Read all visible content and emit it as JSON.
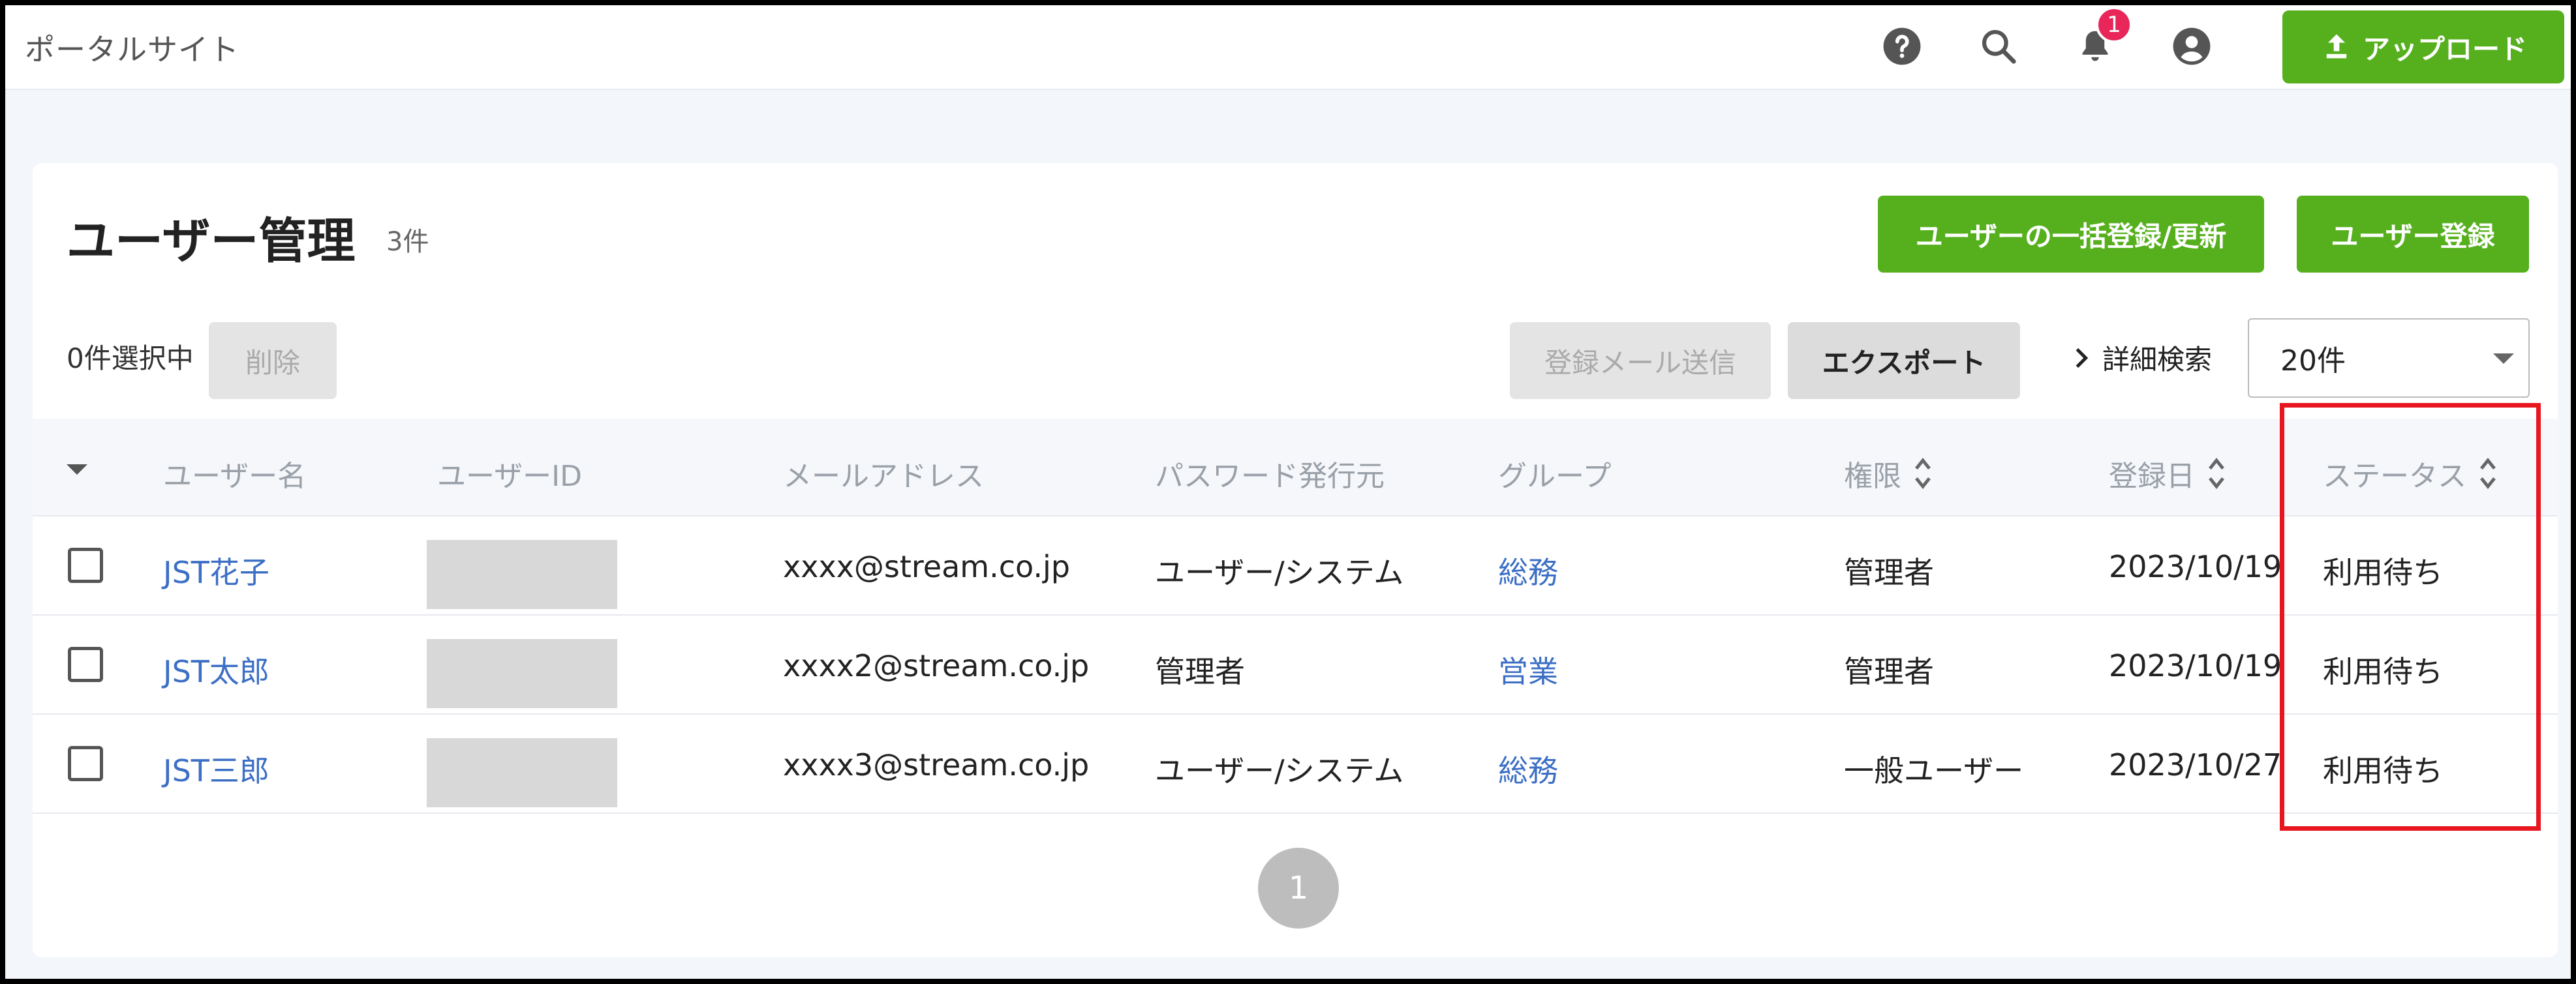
{
  "header": {
    "site_title": "ポータルサイト",
    "help_icon": "help-circle-icon",
    "search_icon": "search-icon",
    "bell_icon": "bell-icon",
    "notification_count": "1",
    "account_icon": "account-circle-icon",
    "upload_label": "アップロード"
  },
  "page": {
    "title": "ユーザー管理",
    "count": "3件",
    "bulk_register_label": "ユーザーの一括登録/更新",
    "register_label": "ユーザー登録",
    "selected_text": "0件選択中",
    "delete_label": "削除",
    "send_mail_label": "登録メール送信",
    "export_label": "エクスポート",
    "advanced_search_label": "詳細検索",
    "per_page_value": "20件"
  },
  "table": {
    "columns": [
      "ユーザー名",
      "ユーザーID",
      "メールアドレス",
      "パスワード発行元",
      "グループ",
      "権限",
      "登録日",
      "ステータス"
    ],
    "rows": [
      {
        "name": "JST花子",
        "email": "xxxx@stream.co.jp",
        "issuer": "ユーザー/システム",
        "group": "総務",
        "role": "管理者",
        "date": "2023/10/19",
        "status": "利用待ち"
      },
      {
        "name": "JST太郎",
        "email": "xxxx2@stream.co.jp",
        "issuer": "管理者",
        "group": "営業",
        "role": "管理者",
        "date": "2023/10/19",
        "status": "利用待ち"
      },
      {
        "name": "JST三郎",
        "email": "xxxx3@stream.co.jp",
        "issuer": "ユーザー/システム",
        "group": "総務",
        "role": "一般ユーザー",
        "date": "2023/10/27",
        "status": "利用待ち"
      }
    ]
  },
  "pagination": {
    "current": "1"
  },
  "colors": {
    "accent": "#56b01e",
    "link": "#3c6fc5",
    "badge": "#e8265a",
    "highlight": "#e8171f"
  }
}
